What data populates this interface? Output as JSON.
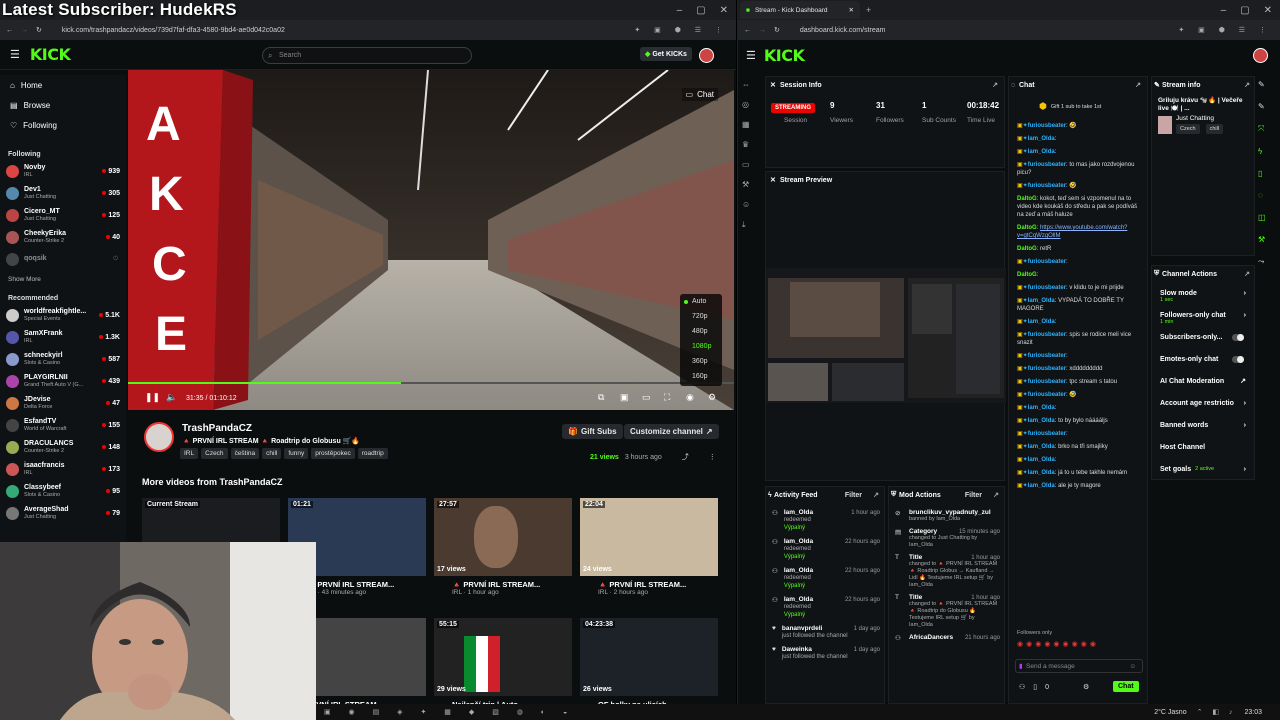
{
  "overlay": {
    "title": "Latest Subscriber: HudekRS"
  },
  "left_browser": {
    "url": "kick.com/trashpandacz/videos/739d7faf-dfa3-4580-9bd4-ae0d042c0a02",
    "search_placeholder": "Search",
    "get_kicks": "Get KICKs",
    "nav": {
      "home": "Home",
      "browse": "Browse",
      "following": "Following"
    },
    "following_heading": "Following",
    "following": [
      {
        "name": "Novby",
        "cat": "IRL",
        "viewers": "939"
      },
      {
        "name": "Dev1",
        "cat": "Just Chatting",
        "viewers": "305"
      },
      {
        "name": "Cicero_MT",
        "cat": "Just Chatting",
        "viewers": "125"
      },
      {
        "name": "CheekyErika",
        "cat": "Counter-Strike 2",
        "viewers": "40"
      },
      {
        "name": "qoqsik",
        "cat": "",
        "viewers": ""
      }
    ],
    "show_more": "Show More",
    "recommended_heading": "Recommended",
    "recommended": [
      {
        "name": "worldfreakfightle...",
        "cat": "Special Events",
        "viewers": "5.1K"
      },
      {
        "name": "SamXFrank",
        "cat": "IRL",
        "viewers": "1.3K"
      },
      {
        "name": "schneckyirl",
        "cat": "Slots & Casino",
        "viewers": "587"
      },
      {
        "name": "PLAYGIRLNII",
        "cat": "Grand Theft Auto V (G...",
        "viewers": "439"
      },
      {
        "name": "JDevise",
        "cat": "Delta Force",
        "viewers": "47"
      },
      {
        "name": "EsfandTV",
        "cat": "World of Warcraft",
        "viewers": "155"
      },
      {
        "name": "DRACULANCS",
        "cat": "Counter-Strike 2",
        "viewers": "148"
      },
      {
        "name": "isaacfrancis",
        "cat": "IRL",
        "viewers": "173"
      },
      {
        "name": "Classybeef",
        "cat": "Slots & Casino",
        "viewers": "95"
      },
      {
        "name": "AverageShad",
        "cat": "Just Chatting",
        "viewers": "79"
      }
    ],
    "video": {
      "chat_label": "Chat",
      "time": "31:35 / 01:10:12",
      "progress": 0.45,
      "sign_text": "AKCE",
      "qualities": [
        "Auto",
        "720p",
        "480p",
        "1080p",
        "360p",
        "160p"
      ],
      "selected_quality": "1080p"
    },
    "channel": {
      "name": "TrashPandaCZ",
      "title": "🔺 PRVNÍ IRL STREAM 🔺 Roadtrip do Globusu 🛒🔥",
      "tags": [
        "IRL",
        "Czech",
        "čeština",
        "chill",
        "funny",
        "prostěpokec",
        "roadtrip"
      ],
      "views": "21 views",
      "ago": "3 hours ago",
      "gift_subs": "Gift Subs",
      "customize": "Customize channel"
    },
    "more_heading": "More videos from TrashPandaCZ",
    "videos": [
      {
        "dur": "Current Stream",
        "views": "",
        "title": "",
        "sub": ""
      },
      {
        "dur": "01:21",
        "views": "",
        "title": "🔺 PRVNÍ IRL STREAM...",
        "sub": "IRL · 43 minutes ago"
      },
      {
        "dur": "27:57",
        "views": "17 views",
        "title": "🔺 PRVNÍ IRL STREAM...",
        "sub": "IRL · 1 hour ago"
      },
      {
        "dur": "22:04",
        "views": "24 views",
        "title": "🔺 PRVNÍ IRL STREAM...",
        "sub": "IRL · 2 hours ago"
      },
      {
        "dur": "2",
        "views": "",
        "title": "PRVNÍ IRL STREAM",
        "sub": ""
      },
      {
        "dur": "55:15",
        "views": "29 views",
        "title": "Nejlepší trip | Auto",
        "sub": ""
      },
      {
        "dur": "04:23:38",
        "views": "26 views",
        "title": "OF holky na ulicích",
        "sub": ""
      }
    ]
  },
  "right_browser": {
    "tab": "Stream - Kick Dashboard",
    "url": "dashboard.kick.com/stream",
    "session_info": {
      "title": "Session Info",
      "badge": "STREAMING",
      "stats": [
        {
          "value": "",
          "label": "Session"
        },
        {
          "value": "9",
          "label": "Viewers"
        },
        {
          "value": "31",
          "label": "Followers"
        },
        {
          "value": "1",
          "label": "Sub Counts"
        },
        {
          "value": "00:18:42",
          "label": "Time Live"
        }
      ]
    },
    "stream_preview": {
      "title": "Stream Preview"
    },
    "chat": {
      "title": "Chat",
      "goal": "Gift 1 sub to take 1st",
      "lines": [
        {
          "u": "furiousbeater",
          "m": "🤣"
        },
        {
          "u": "Iam_Olda",
          "m": ""
        },
        {
          "u": "Iam_Olda",
          "m": ""
        },
        {
          "u": "furiousbeater",
          "m": "to mas jako rozdvojenou picu?"
        },
        {
          "u": "furiousbeater",
          "m": "🤣"
        },
        {
          "u": "DaltoG",
          "m": "kokot, teď sem si vzpomenul na to video kde koukáš do středu a pak se podíváš na zeď a máš haluze"
        },
        {
          "u": "DaltoG",
          "m": "https://www.youtube.com/watch?v=gtCqWzgOllM"
        },
        {
          "u": "DaltoG",
          "m": "retR"
        },
        {
          "u": "furiousbeater",
          "m": ""
        },
        {
          "u": "DaltoG",
          "m": ""
        },
        {
          "u": "furiousbeater",
          "m": "v klidu to je mi prijde"
        },
        {
          "u": "Iam_Olda",
          "m": "VYPADÁ TO DOBŘE TY MAGORE"
        },
        {
          "u": "Iam_Olda",
          "m": ""
        },
        {
          "u": "furiousbeater",
          "m": "spis se rodice meli vice snazit"
        },
        {
          "u": "furiousbeater",
          "m": ""
        },
        {
          "u": "furiousbeater",
          "m": "xddddddddd"
        },
        {
          "u": "furiousbeater",
          "m": "tpc stream s tatou"
        },
        {
          "u": "furiousbeater",
          "m": "🤣"
        },
        {
          "u": "Iam_Olda",
          "m": ""
        },
        {
          "u": "Iam_Olda",
          "m": "to by bylo nááááljs"
        },
        {
          "u": "furiousbeater",
          "m": ""
        },
        {
          "u": "Iam_Olda",
          "m": "brko na tři smajliky"
        },
        {
          "u": "Iam_Olda",
          "m": ""
        },
        {
          "u": "Iam_Olda",
          "m": "já to u tebe takhle nemám"
        },
        {
          "u": "Iam_Olda",
          "m": "ale je ty magore"
        }
      ],
      "followers_only": "Followers only",
      "placeholder": "Send a message",
      "count": "0",
      "send": "Chat"
    },
    "stream_info": {
      "title": "Stream info",
      "stream_title": "Griluju krávu 🐄🔥 | Večeře live 🍽️ | ...",
      "category": "Just Chatting",
      "tags": [
        "Czech",
        "chill"
      ]
    },
    "channel_actions": {
      "title": "Channel Actions",
      "items": [
        {
          "label": "Slow mode",
          "sub": "1 sec",
          "ctl": "chevron"
        },
        {
          "label": "Followers-only chat",
          "sub": "1 min",
          "ctl": "chevron"
        },
        {
          "label": "Subscribers-only...",
          "sub": "",
          "ctl": "toggle"
        },
        {
          "label": "Emotes-only chat",
          "sub": "",
          "ctl": "toggle"
        },
        {
          "label": "AI Chat Moderation",
          "sub": "",
          "ctl": "link"
        },
        {
          "label": "Account age restrictio",
          "sub": "",
          "ctl": "chevron"
        },
        {
          "label": "Banned words",
          "sub": "",
          "ctl": "chevron"
        },
        {
          "label": "Host Channel",
          "sub": "",
          "ctl": ""
        },
        {
          "label": "Set goals",
          "sub": "",
          "ctl": "chevron",
          "note": "2 active"
        }
      ]
    },
    "activity_feed": {
      "title": "Activity Feed",
      "filter": "Filter",
      "items": [
        {
          "who": "Iam_Olda",
          "what": "redeemed",
          "tag": "Výpalný",
          "time": "1 hour ago"
        },
        {
          "who": "Iam_Olda",
          "what": "redeemed",
          "tag": "Výpalný",
          "time": "22 hours ago"
        },
        {
          "who": "Iam_Olda",
          "what": "redeemed",
          "tag": "Výpalný",
          "time": "22 hours ago"
        },
        {
          "who": "Iam_Olda",
          "what": "redeemed",
          "tag": "Výpalný",
          "time": "22 hours ago"
        },
        {
          "who": "bananvprdeli",
          "what": "just followed the channel",
          "tag": "",
          "time": "1 day ago"
        },
        {
          "who": "Daweinka",
          "what": "just followed the channel",
          "tag": "",
          "time": "1 day ago"
        }
      ]
    },
    "mod_actions": {
      "title": "Mod Actions",
      "filter": "Filter",
      "items": [
        {
          "head": "brunclikuv_vypadnuty_zul",
          "desc": "banned by Iam_Olda",
          "time": ""
        },
        {
          "head": "Category",
          "desc": "changed to Just Chatting by Iam_Olda",
          "time": "15 minutes ago"
        },
        {
          "head": "Title",
          "desc": "changed to 🔺 PRVNÍ IRL STREAM 🔺 Roadtrip Globus → Kaufland → Lidl 🔥 Testujeme IRL setup 🛒 by Iam_Olda",
          "time": "1 hour ago"
        },
        {
          "head": "Title",
          "desc": "changed to 🔺 PRVNÍ IRL STREAM 🔺 Roadtrip do Globusu 🔥 Testujeme IRL setup 🛒 by Iam_Olda",
          "time": "1 hour ago"
        },
        {
          "head": "AfricaDancers",
          "desc": "",
          "time": "21 hours ago"
        }
      ]
    }
  },
  "taskbar": {
    "weather": "2°C Jasno",
    "time": "23:03"
  }
}
